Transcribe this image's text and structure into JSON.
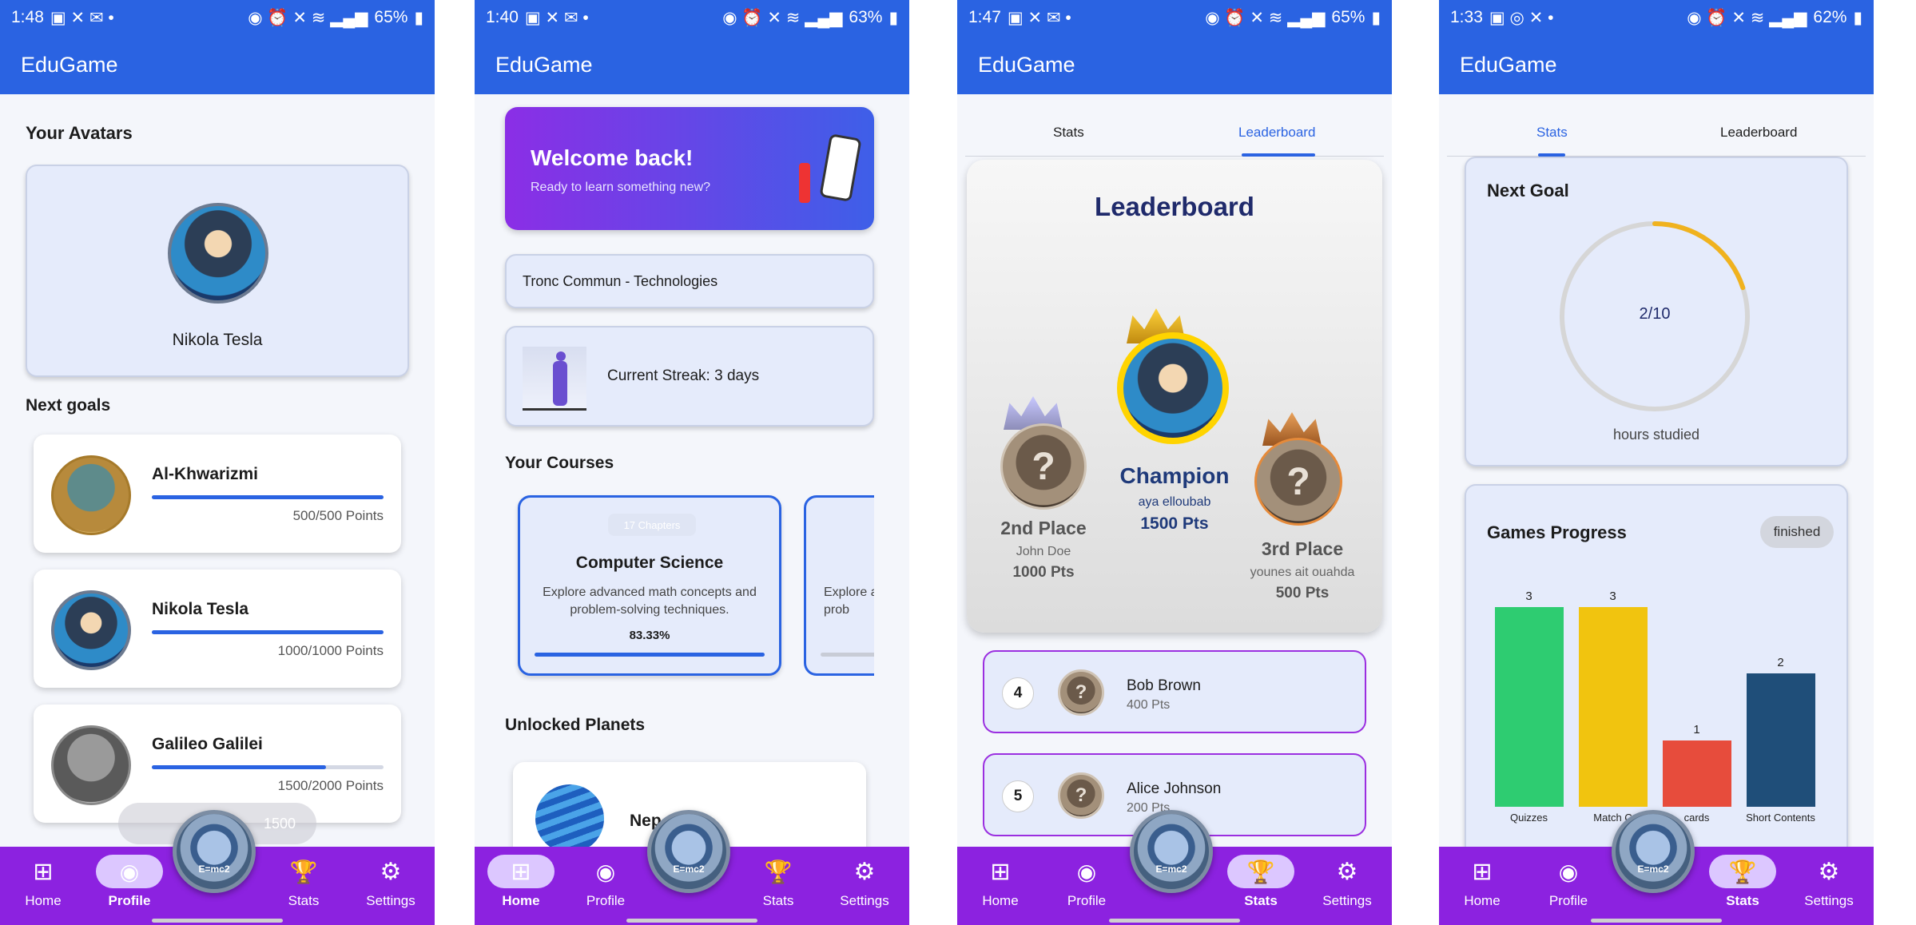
{
  "app_title": "EduGame",
  "nav": {
    "home": "Home",
    "profile": "Profile",
    "stats": "Stats",
    "settings": "Settings"
  },
  "screens": [
    {
      "time": "1:48",
      "battery": "65%",
      "avatars_heading": "Your Avatars",
      "selected_avatar": "Nikola Tesla",
      "next_goals_heading": "Next goals",
      "goals": [
        {
          "name": "Al-Khwarizmi",
          "points": "500/500 Points",
          "progress": 1.0
        },
        {
          "name": "Nikola Tesla",
          "points": "1000/1000 Points",
          "progress": 1.0
        },
        {
          "name": "Galileo Galilei",
          "points": "1500/2000 Points",
          "progress": 0.75
        }
      ],
      "toast_value": "1500",
      "active_nav": "profile"
    },
    {
      "time": "1:40",
      "battery": "63%",
      "welcome_title": "Welcome back!",
      "welcome_subtitle": "Ready to learn something new?",
      "program": "Tronc Commun - Technologies",
      "streak": "Current Streak: 3 days",
      "courses_heading": "Your Courses",
      "course": {
        "chapters": "17 Chapters",
        "title": "Computer Science",
        "description": "Explore advanced math concepts and problem-solving techniques.",
        "progress_label": "83.33%",
        "progress": 0.8333
      },
      "course2_desc": "Explore a prob",
      "planets_heading": "Unlocked Planets",
      "planet_name": "Nep",
      "active_nav": "home"
    },
    {
      "time": "1:47",
      "battery": "65%",
      "tabs": [
        "Stats",
        "Leaderboard"
      ],
      "active_tab": 1,
      "leaderboard_title": "Leaderboard",
      "first": {
        "label": "Champion",
        "name": "aya elloubab",
        "points": "1500 Pts"
      },
      "second": {
        "label": "2nd Place",
        "name": "John Doe",
        "points": "1000 Pts"
      },
      "third": {
        "label": "3rd Place",
        "name": "younes ait ouahda",
        "points": "500 Pts"
      },
      "rows": [
        {
          "rank": "4",
          "name": "Bob Brown",
          "points": "400 Pts"
        },
        {
          "rank": "5",
          "name": "Alice Johnson",
          "points": "200 Pts"
        }
      ],
      "active_nav": "stats"
    },
    {
      "time": "1:33",
      "battery": "62%",
      "tabs": [
        "Stats",
        "Leaderboard"
      ],
      "active_tab": 0,
      "next_goal_heading": "Next Goal",
      "goal_value": "2/10",
      "goal_fraction": 0.2,
      "goal_caption": "hours studied",
      "games_heading": "Games Progress",
      "badge": "finished",
      "active_nav": "stats"
    }
  ],
  "chart_data": {
    "type": "bar",
    "categories": [
      "Quizzes",
      "Match C",
      "cards",
      "Short Contents"
    ],
    "values": [
      3,
      3,
      1,
      2
    ],
    "colors": [
      "#2ecc71",
      "#f1c40f",
      "#e74c3c",
      "#1f4e79"
    ],
    "ylim": [
      0,
      3
    ]
  }
}
